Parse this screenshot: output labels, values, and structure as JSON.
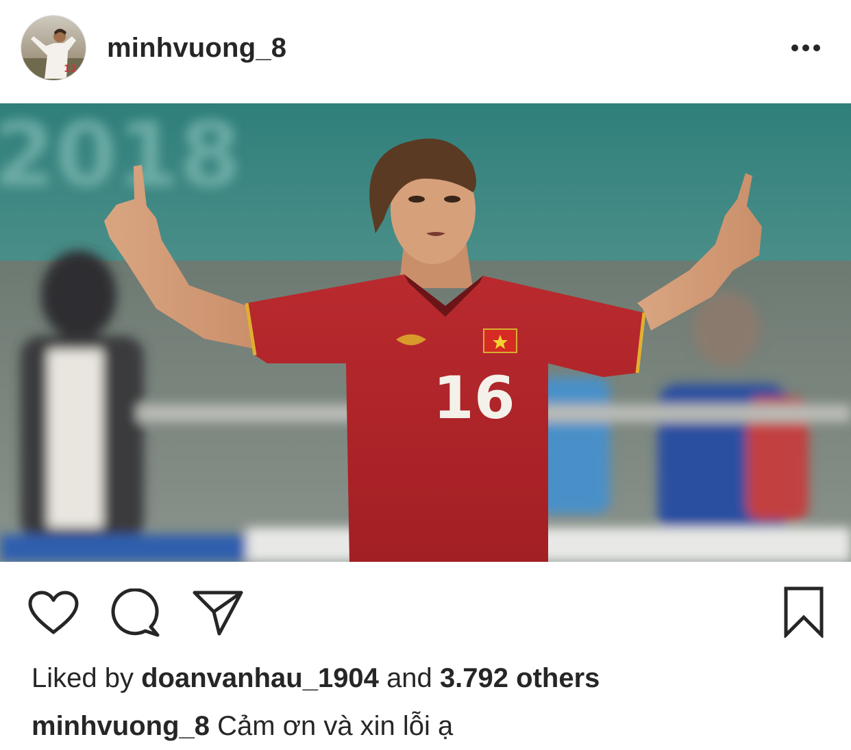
{
  "header": {
    "username": "minhvuong_8",
    "avatar_icon": "profile-avatar",
    "more_icon": "more-options-icon"
  },
  "photo": {
    "jersey_number": "16",
    "banner_text": "2018",
    "colors": {
      "jersey": "#b5252a",
      "stadium_teal": "#3e8a86",
      "banner_blue": "#2f5fae"
    }
  },
  "actions": {
    "like_icon": "heart-icon",
    "comment_icon": "comment-icon",
    "share_icon": "paper-plane-icon",
    "save_icon": "bookmark-icon"
  },
  "likes": {
    "prefix": "Liked by",
    "liker": "doanvanhau_1904",
    "connector": "and",
    "others": "3.792 others"
  },
  "caption": {
    "username": "minhvuong_8",
    "text": "Cảm ơn và xin lỗi ạ"
  },
  "colors": {
    "text": "#262626",
    "background": "#ffffff"
  }
}
